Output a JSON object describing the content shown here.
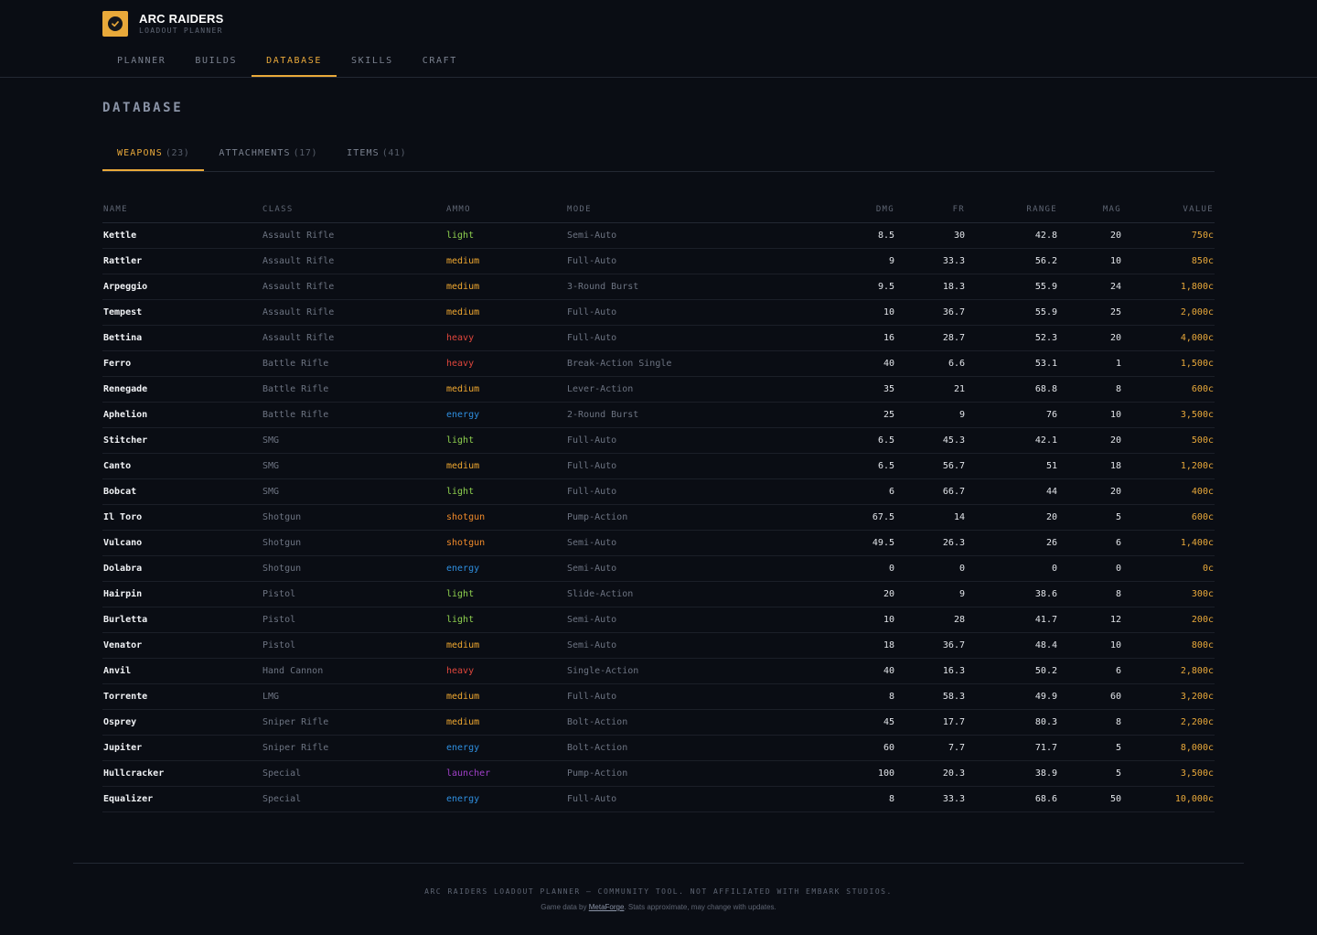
{
  "app": {
    "name": "ARC RAIDERS",
    "subtitle": "LOADOUT PLANNER",
    "accent": "#e9a93a",
    "logo_icon": "check-icon"
  },
  "nav": {
    "items": [
      {
        "label": "PLANNER",
        "active": false
      },
      {
        "label": "BUILDS",
        "active": false
      },
      {
        "label": "DATABASE",
        "active": true
      },
      {
        "label": "SKILLS",
        "active": false
      },
      {
        "label": "CRAFT",
        "active": false
      }
    ]
  },
  "page": {
    "title": "DATABASE"
  },
  "subtabs": [
    {
      "label": "WEAPONS",
      "count": "(23)",
      "active": true
    },
    {
      "label": "ATTACHMENTS",
      "count": "(17)",
      "active": false
    },
    {
      "label": "ITEMS",
      "count": "(41)",
      "active": false
    }
  ],
  "table": {
    "columns": [
      "NAME",
      "CLASS",
      "AMMO",
      "MODE",
      "DMG",
      "FR",
      "RANGE",
      "MAG",
      "VALUE"
    ],
    "ammo_colors": {
      "light": "#8fd14f",
      "medium": "#f0a830",
      "heavy": "#e0463c",
      "energy": "#2f8fe0",
      "shotgun": "#f08a2a",
      "launcher": "#a040c8"
    },
    "rows": [
      {
        "name": "Kettle",
        "class": "Assault Rifle",
        "ammo": "light",
        "mode": "Semi-Auto",
        "dmg": "8.5",
        "fr": "30",
        "range": "42.8",
        "mag": "20",
        "value": "750c"
      },
      {
        "name": "Rattler",
        "class": "Assault Rifle",
        "ammo": "medium",
        "mode": "Full-Auto",
        "dmg": "9",
        "fr": "33.3",
        "range": "56.2",
        "mag": "10",
        "value": "850c"
      },
      {
        "name": "Arpeggio",
        "class": "Assault Rifle",
        "ammo": "medium",
        "mode": "3-Round Burst",
        "dmg": "9.5",
        "fr": "18.3",
        "range": "55.9",
        "mag": "24",
        "value": "1,800c"
      },
      {
        "name": "Tempest",
        "class": "Assault Rifle",
        "ammo": "medium",
        "mode": "Full-Auto",
        "dmg": "10",
        "fr": "36.7",
        "range": "55.9",
        "mag": "25",
        "value": "2,000c"
      },
      {
        "name": "Bettina",
        "class": "Assault Rifle",
        "ammo": "heavy",
        "mode": "Full-Auto",
        "dmg": "16",
        "fr": "28.7",
        "range": "52.3",
        "mag": "20",
        "value": "4,000c"
      },
      {
        "name": "Ferro",
        "class": "Battle Rifle",
        "ammo": "heavy",
        "mode": "Break-Action Single",
        "dmg": "40",
        "fr": "6.6",
        "range": "53.1",
        "mag": "1",
        "value": "1,500c"
      },
      {
        "name": "Renegade",
        "class": "Battle Rifle",
        "ammo": "medium",
        "mode": "Lever-Action",
        "dmg": "35",
        "fr": "21",
        "range": "68.8",
        "mag": "8",
        "value": "600c"
      },
      {
        "name": "Aphelion",
        "class": "Battle Rifle",
        "ammo": "energy",
        "mode": "2-Round Burst",
        "dmg": "25",
        "fr": "9",
        "range": "76",
        "mag": "10",
        "value": "3,500c"
      },
      {
        "name": "Stitcher",
        "class": "SMG",
        "ammo": "light",
        "mode": "Full-Auto",
        "dmg": "6.5",
        "fr": "45.3",
        "range": "42.1",
        "mag": "20",
        "value": "500c"
      },
      {
        "name": "Canto",
        "class": "SMG",
        "ammo": "medium",
        "mode": "Full-Auto",
        "dmg": "6.5",
        "fr": "56.7",
        "range": "51",
        "mag": "18",
        "value": "1,200c"
      },
      {
        "name": "Bobcat",
        "class": "SMG",
        "ammo": "light",
        "mode": "Full-Auto",
        "dmg": "6",
        "fr": "66.7",
        "range": "44",
        "mag": "20",
        "value": "400c"
      },
      {
        "name": "Il Toro",
        "class": "Shotgun",
        "ammo": "shotgun",
        "mode": "Pump-Action",
        "dmg": "67.5",
        "fr": "14",
        "range": "20",
        "mag": "5",
        "value": "600c"
      },
      {
        "name": "Vulcano",
        "class": "Shotgun",
        "ammo": "shotgun",
        "mode": "Semi-Auto",
        "dmg": "49.5",
        "fr": "26.3",
        "range": "26",
        "mag": "6",
        "value": "1,400c"
      },
      {
        "name": "Dolabra",
        "class": "Shotgun",
        "ammo": "energy",
        "mode": "Semi-Auto",
        "dmg": "0",
        "fr": "0",
        "range": "0",
        "mag": "0",
        "value": "0c"
      },
      {
        "name": "Hairpin",
        "class": "Pistol",
        "ammo": "light",
        "mode": "Slide-Action",
        "dmg": "20",
        "fr": "9",
        "range": "38.6",
        "mag": "8",
        "value": "300c"
      },
      {
        "name": "Burletta",
        "class": "Pistol",
        "ammo": "light",
        "mode": "Semi-Auto",
        "dmg": "10",
        "fr": "28",
        "range": "41.7",
        "mag": "12",
        "value": "200c"
      },
      {
        "name": "Venator",
        "class": "Pistol",
        "ammo": "medium",
        "mode": "Semi-Auto",
        "dmg": "18",
        "fr": "36.7",
        "range": "48.4",
        "mag": "10",
        "value": "800c"
      },
      {
        "name": "Anvil",
        "class": "Hand Cannon",
        "ammo": "heavy",
        "mode": "Single-Action",
        "dmg": "40",
        "fr": "16.3",
        "range": "50.2",
        "mag": "6",
        "value": "2,800c"
      },
      {
        "name": "Torrente",
        "class": "LMG",
        "ammo": "medium",
        "mode": "Full-Auto",
        "dmg": "8",
        "fr": "58.3",
        "range": "49.9",
        "mag": "60",
        "value": "3,200c"
      },
      {
        "name": "Osprey",
        "class": "Sniper Rifle",
        "ammo": "medium",
        "mode": "Bolt-Action",
        "dmg": "45",
        "fr": "17.7",
        "range": "80.3",
        "mag": "8",
        "value": "2,200c"
      },
      {
        "name": "Jupiter",
        "class": "Sniper Rifle",
        "ammo": "energy",
        "mode": "Bolt-Action",
        "dmg": "60",
        "fr": "7.7",
        "range": "71.7",
        "mag": "5",
        "value": "8,000c"
      },
      {
        "name": "Hullcracker",
        "class": "Special",
        "ammo": "launcher",
        "mode": "Pump-Action",
        "dmg": "100",
        "fr": "20.3",
        "range": "38.9",
        "mag": "5",
        "value": "3,500c"
      },
      {
        "name": "Equalizer",
        "class": "Special",
        "ammo": "energy",
        "mode": "Full-Auto",
        "dmg": "8",
        "fr": "33.3",
        "range": "68.6",
        "mag": "50",
        "value": "10,000c"
      }
    ]
  },
  "footer": {
    "main": "ARC RAIDERS LOADOUT PLANNER — COMMUNITY TOOL. NOT AFFILIATED WITH EMBARK STUDIOS.",
    "sub_prefix": "Game data by ",
    "sub_link": "MetaForge",
    "sub_suffix": ". Stats approximate, may change with updates."
  }
}
